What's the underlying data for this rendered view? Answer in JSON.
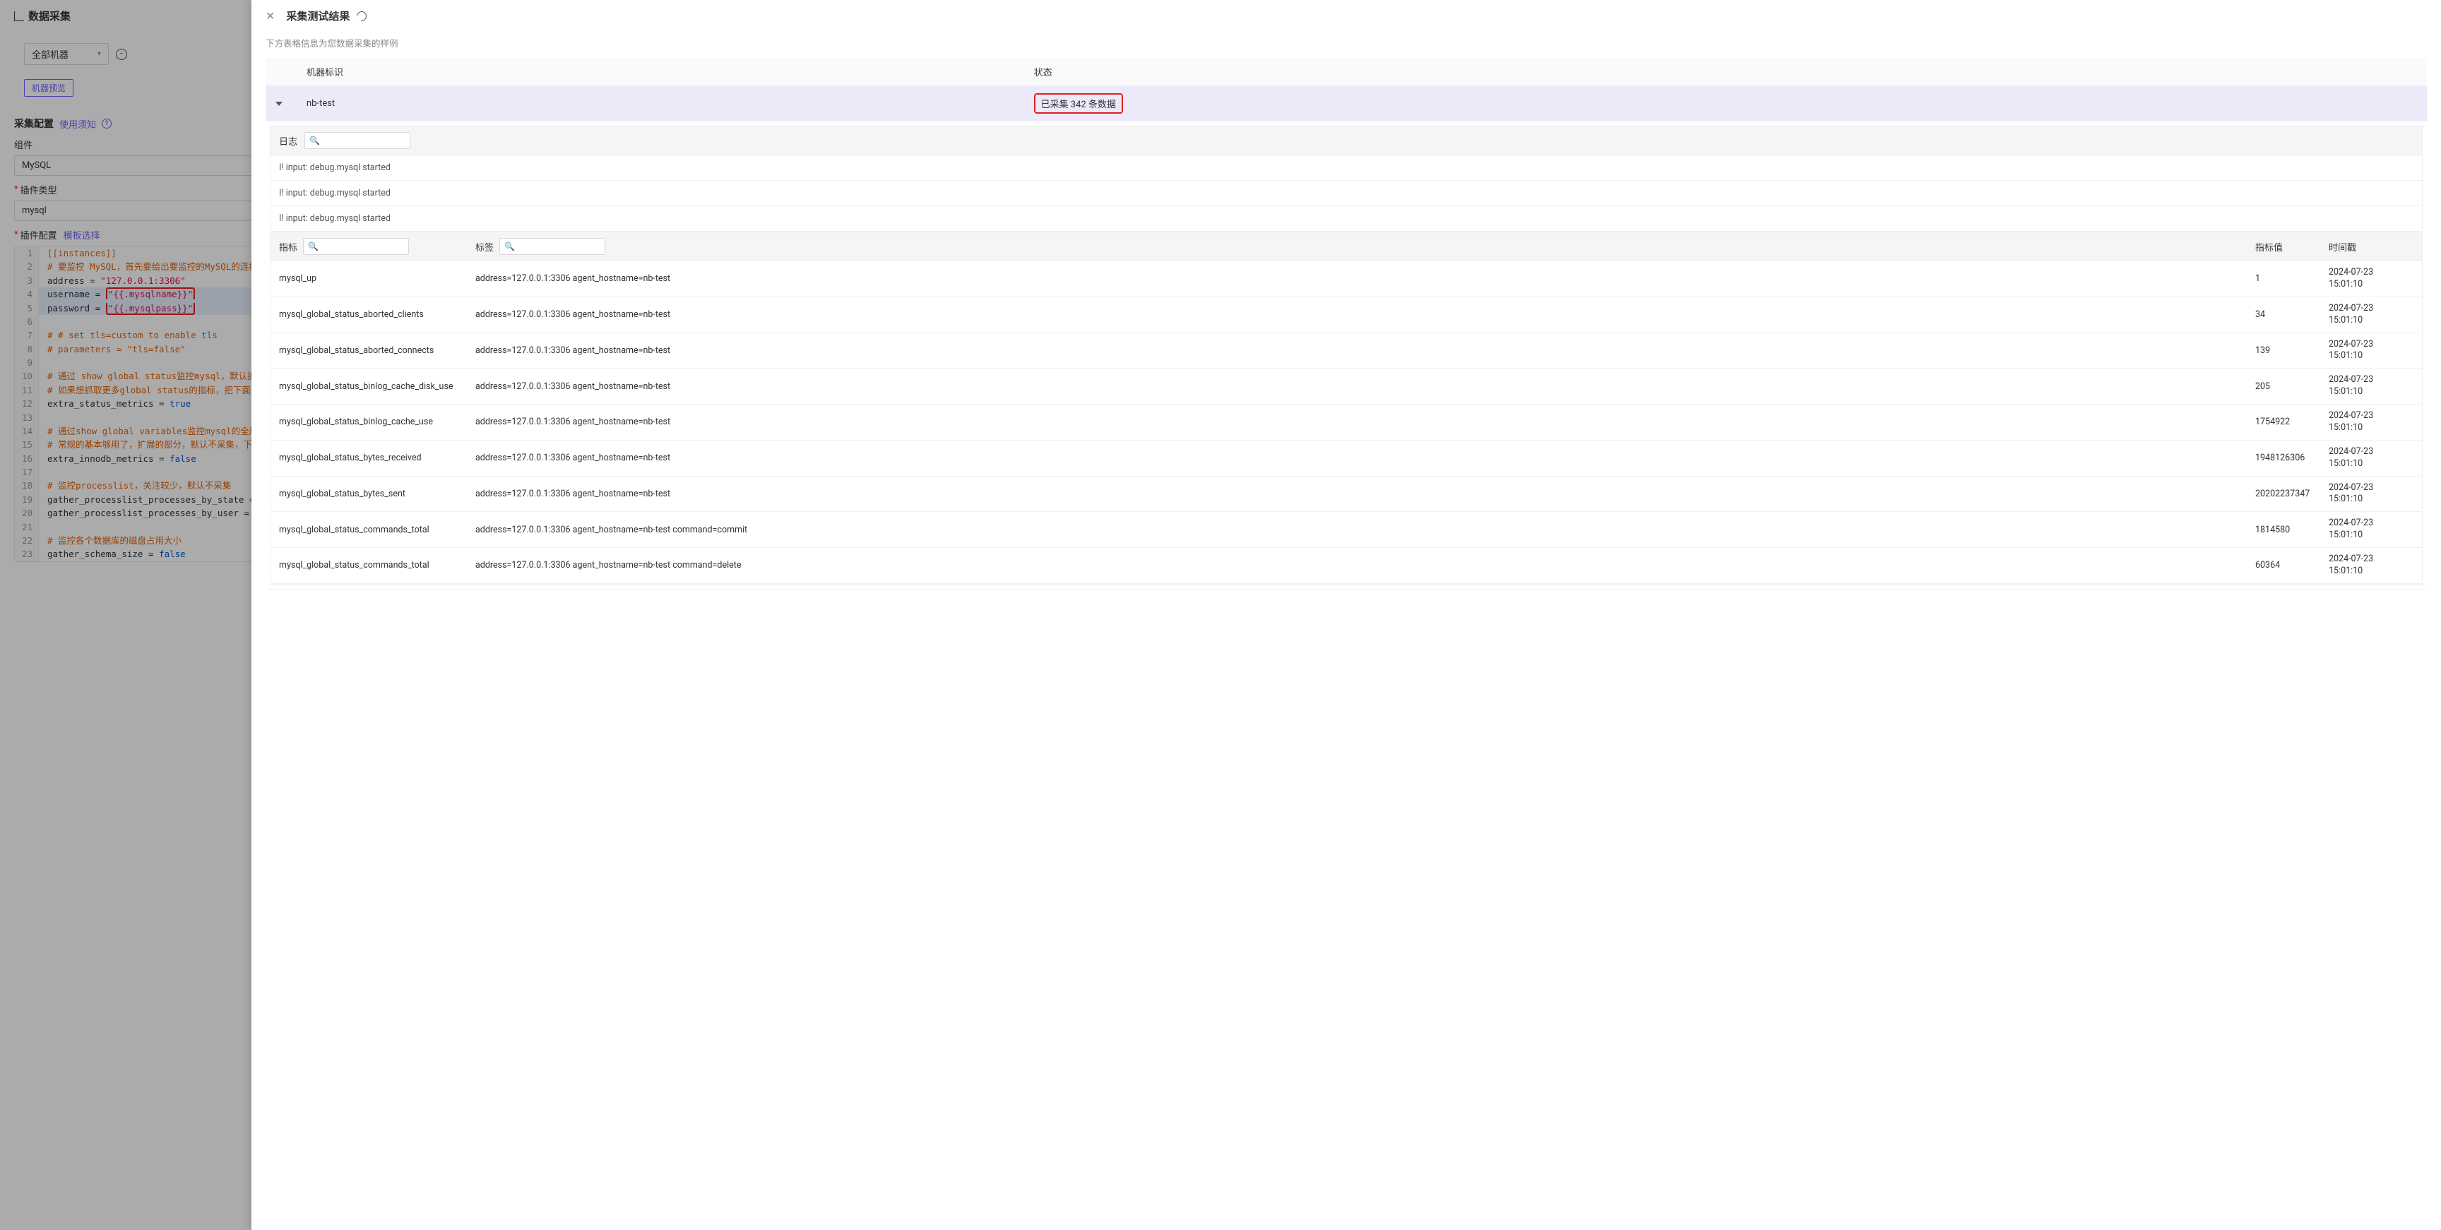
{
  "page_title": "数据采集",
  "machine_select": {
    "label": "全部机器"
  },
  "machine_preview_btn": "机器预览",
  "section_config": {
    "title": "采集配置",
    "usage_link": "使用须知"
  },
  "fields": {
    "component_label": "组件",
    "component_value": "MySQL",
    "plugin_type_label": "插件类型",
    "plugin_type_value": "mysql",
    "plugin_config_label": "插件配置",
    "template_link": "模板选择"
  },
  "code": {
    "l1": "[[instances]]",
    "l2": "# 要监控 MySQL，首先要给出要监控的MySQL的连接地址、用",
    "l3a": "address = ",
    "l3b": "\"127.0.0.1:3306\"",
    "l4a": "username = ",
    "l4b": "\"{{.mysqlname}}\"",
    "l5a": "password = ",
    "l5b": "\"{{.mysqlpass}}\"",
    "l7": "# # set tls=custom to enable tls",
    "l8": "# parameters = \"tls=false\"",
    "l10": "# 通过 show global status监控mysql，默认抓取一些",
    "l11": "# 如果想抓取更多global status的指标，把下面的配置设",
    "l12a": "extra_status_metrics = ",
    "l12b": "true",
    "l14": "# 通过show global variables监控mysql的全局变量，",
    "l15": "# 常规的基本够用了，扩展的部分，默认不采集，下面的配置",
    "l16a": "extra_innodb_metrics = ",
    "l16b": "false",
    "l18": "# 监控processlist，关注较少，默认不采集",
    "l19a": "gather_processlist_processes_by_state = ",
    "l19b": "false",
    "l20a": "gather_processlist_processes_by_user = ",
    "l20b": "false",
    "l22": "# 监控各个数据库的磁盘占用大小",
    "l23a": "gather_schema_size = ",
    "l23b": "false"
  },
  "drawer": {
    "title": "采集测试结果",
    "subtitle": "下方表格信息为您数据采集的样例",
    "cols": {
      "machine": "机器标识",
      "status": "状态"
    },
    "row": {
      "machine": "nb-test",
      "status": "已采集 342 条数据"
    },
    "log_label": "日志",
    "logs": [
      "I! input: debug.mysql started",
      "I! input: debug.mysql started",
      "I! input: debug.mysql started"
    ],
    "metric_head": {
      "metric": "指标",
      "tag": "标签",
      "value": "指标值",
      "time": "时间戳"
    },
    "ts_date": "2024-07-23",
    "ts_time": "15:01:10",
    "tag_base": "address=127.0.0.1:3306 agent_hostname=nb-test",
    "metrics": [
      {
        "m": "mysql_up",
        "tag": "address=127.0.0.1:3306 agent_hostname=nb-test",
        "v": "1"
      },
      {
        "m": "mysql_global_status_aborted_clients",
        "tag": "address=127.0.0.1:3306 agent_hostname=nb-test",
        "v": "34"
      },
      {
        "m": "mysql_global_status_aborted_connects",
        "tag": "address=127.0.0.1:3306 agent_hostname=nb-test",
        "v": "139"
      },
      {
        "m": "mysql_global_status_binlog_cache_disk_use",
        "tag": "address=127.0.0.1:3306 agent_hostname=nb-test",
        "v": "205"
      },
      {
        "m": "mysql_global_status_binlog_cache_use",
        "tag": "address=127.0.0.1:3306 agent_hostname=nb-test",
        "v": "1754922"
      },
      {
        "m": "mysql_global_status_bytes_received",
        "tag": "address=127.0.0.1:3306 agent_hostname=nb-test",
        "v": "1948126306"
      },
      {
        "m": "mysql_global_status_bytes_sent",
        "tag": "address=127.0.0.1:3306 agent_hostname=nb-test",
        "v": "20202237347"
      },
      {
        "m": "mysql_global_status_commands_total",
        "tag": "address=127.0.0.1:3306 agent_hostname=nb-test command=commit",
        "v": "1814580"
      },
      {
        "m": "mysql_global_status_commands_total",
        "tag": "address=127.0.0.1:3306 agent_hostname=nb-test command=delete",
        "v": "60364"
      }
    ]
  }
}
